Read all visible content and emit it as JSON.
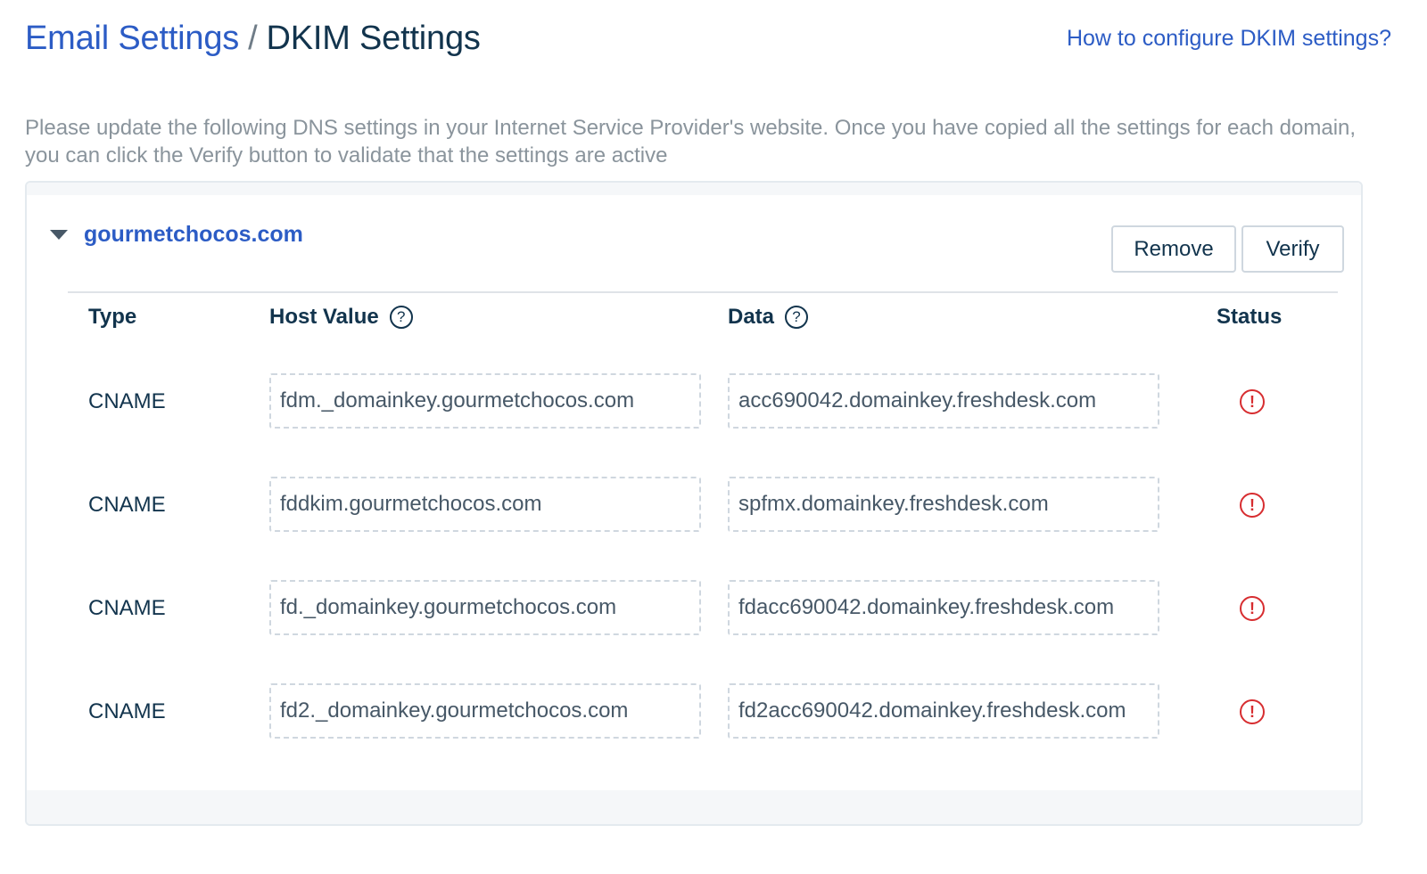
{
  "header": {
    "breadcrumb_parent": "Email Settings",
    "breadcrumb_separator": "/",
    "breadcrumb_current": "DKIM Settings",
    "help_link": "How to configure DKIM settings?"
  },
  "description": "Please update the following DNS settings in your Internet Service Provider's website. Once you have copied all the settings for each domain, you can click the Verify button to validate that the settings are active",
  "domain": {
    "name": "gourmetchocos.com",
    "remove_label": "Remove",
    "verify_label": "Verify"
  },
  "table": {
    "headers": {
      "type": "Type",
      "host_value": "Host Value",
      "data": "Data",
      "status": "Status"
    },
    "help_glyph": "?",
    "status_glyph": "!",
    "rows": [
      {
        "type": "CNAME",
        "host": "fdm._domainkey.gourmetchocos.com",
        "data": "acc690042.domainkey.freshdesk.com",
        "status": "error"
      },
      {
        "type": "CNAME",
        "host": "fddkim.gourmetchocos.com",
        "data": "spfmx.domainkey.freshdesk.com",
        "status": "error"
      },
      {
        "type": "CNAME",
        "host": "fd._domainkey.gourmetchocos.com",
        "data": "fdacc690042.domainkey.freshdesk.com",
        "status": "error"
      },
      {
        "type": "CNAME",
        "host": "fd2._domainkey.gourmetchocos.com",
        "data": "fd2acc690042.domainkey.freshdesk.com",
        "status": "error"
      }
    ]
  },
  "colors": {
    "link": "#2c5cc5",
    "text": "#12344d",
    "muted": "#8a949c",
    "error": "#d72d30"
  }
}
